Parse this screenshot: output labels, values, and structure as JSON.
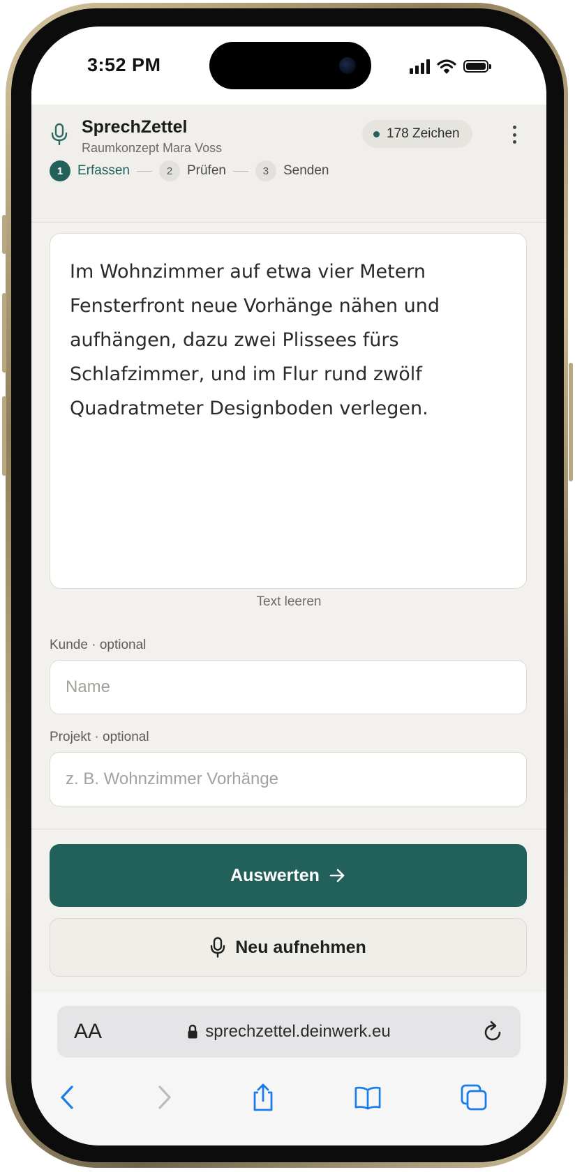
{
  "status_bar": {
    "time": "3:52 PM"
  },
  "app": {
    "title": "SprechZettel",
    "subtitle": "Raumkonzept Mara Voss",
    "char_count": "178 Zeichen",
    "accent_color": "#22605a"
  },
  "steps": [
    {
      "number": "1",
      "label": "Erfassen",
      "active": true
    },
    {
      "number": "2",
      "label": "Prüfen",
      "active": false
    },
    {
      "number": "3",
      "label": "Senden",
      "active": false
    }
  ],
  "transcript": {
    "text": "Im Wohnzimmer auf etwa vier Metern Fensterfront neue Vorhänge nähen und aufhängen, dazu zwei Plissees fürs Schlafzimmer, und im Flur rund zwölf Quadratmeter Designboden verlegen.",
    "clear_label": "Text leeren"
  },
  "form": {
    "customer": {
      "label": "Kunde · optional",
      "placeholder": "Name",
      "value": ""
    },
    "project": {
      "label": "Projekt · optional",
      "placeholder": "z. B. Wohnzimmer Vorhänge",
      "value": ""
    }
  },
  "actions": {
    "primary_label": "Auswerten",
    "secondary_label": "Neu aufnehmen"
  },
  "browser": {
    "text_size_label": "AA",
    "url": "sprechzettel.deinwerk.eu"
  },
  "icons": [
    "microphone-icon",
    "kebab-menu-icon",
    "arrow-right-icon",
    "lock-icon",
    "reload-icon",
    "back-icon",
    "forward-icon",
    "share-icon",
    "bookmarks-icon",
    "tabs-icon",
    "signal-icon",
    "wifi-icon",
    "battery-icon"
  ]
}
